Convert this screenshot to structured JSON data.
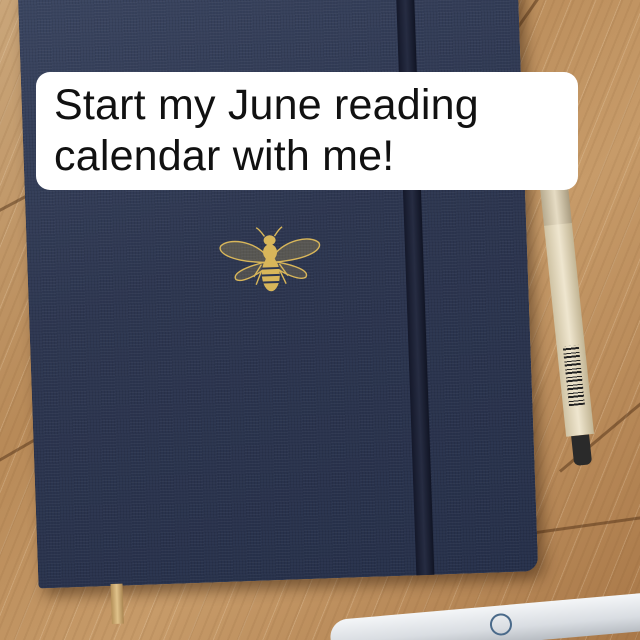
{
  "caption": {
    "line1": "Start my June reading",
    "line2": "calendar with me!"
  },
  "colors": {
    "cover": "#2d3650",
    "bee_gold": "#d8b65a",
    "wood": "#b88a58",
    "caption_background": "#ffffff"
  },
  "icons": [
    "bee-emblem-icon"
  ]
}
